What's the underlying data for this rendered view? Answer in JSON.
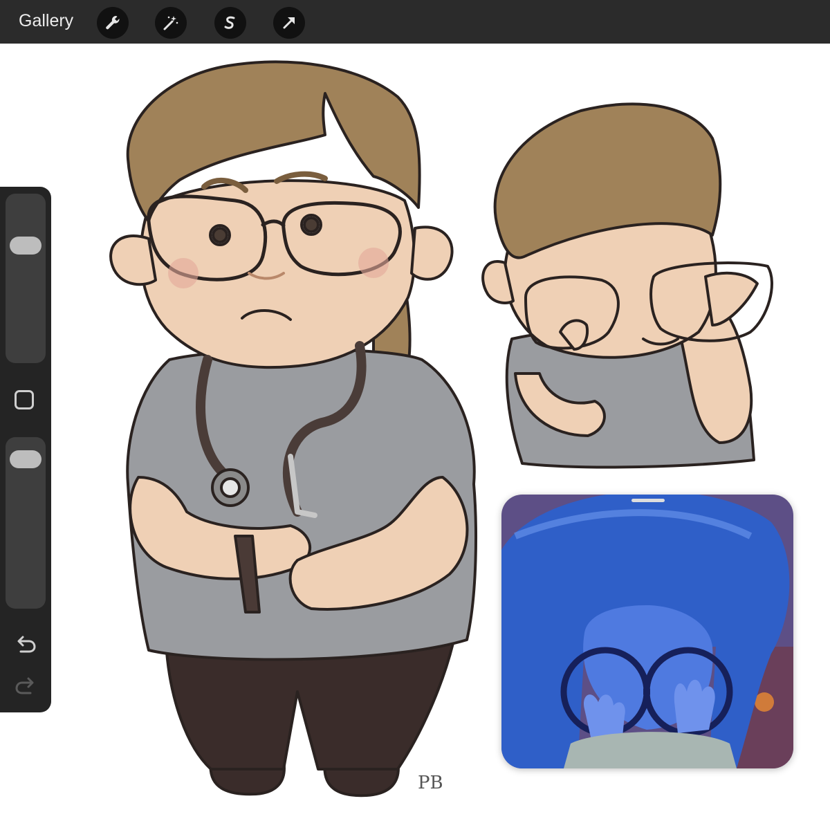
{
  "toolbar": {
    "gallery_label": "Gallery",
    "tools": [
      "wrench-icon",
      "magic-wand-icon",
      "selection-s-icon",
      "transform-arrow-icon"
    ]
  },
  "sidebar": {
    "brush_size_level": 0.73,
    "opacity_level": 0.94,
    "icons": [
      "modify-square-icon",
      "undo-icon",
      "redo-icon"
    ]
  },
  "canvas": {
    "signature": "PB"
  },
  "colors": {
    "toolbar_bg": "#2b2b2b",
    "sidebar_bg": "#242424",
    "hair": "#a08259",
    "skin": "#efd0b5",
    "shirt": "#9a9ca0",
    "pants": "#3a2c2a",
    "sadness_blue": "#2f5fc8"
  }
}
